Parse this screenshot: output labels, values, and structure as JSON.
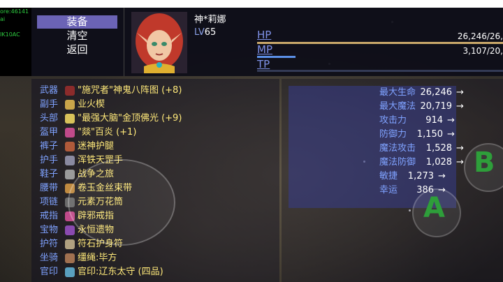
{
  "sidebar": {
    "lines": [
      "ore:46141",
      "ai",
      "",
      "IK10AC"
    ],
    "text_color": "#2ecc40"
  },
  "menu": {
    "items": [
      {
        "label": "装备",
        "selected": true
      },
      {
        "label": "清空",
        "selected": false
      },
      {
        "label": "返回",
        "selected": false
      }
    ],
    "selected_color": "#6b63b5"
  },
  "character": {
    "name": "神*莉娜",
    "level_label": "LV",
    "level": "65",
    "hp_label": "HP",
    "hp_value": "26,246/26,",
    "mp_label": "MP",
    "mp_value": "3,107/20,",
    "tp_label": "TP",
    "hp_fill": 1.0,
    "mp_fill": 0.15,
    "tp_fill": 0.0,
    "hp_color": "#c9a86a",
    "mp_color": "#5b8fe6"
  },
  "equipment": [
    {
      "slot": "武器",
      "icon": "weapon-icon",
      "color": "#8b2b2b",
      "name": "\"施咒者\"神鬼八阵图 (+8)"
    },
    {
      "slot": "副手",
      "icon": "wand-icon",
      "color": "#c9a54a",
      "name": "业火楔"
    },
    {
      "slot": "头部",
      "icon": "helmet-icon",
      "color": "#d8c25a",
      "name": "\"最强大脑\"金顶佛光 (+9)"
    },
    {
      "slot": "盔甲",
      "icon": "armor-icon",
      "color": "#c04a8a",
      "name": "\"燚\"百炎 (+1)"
    },
    {
      "slot": "裤子",
      "icon": "pants-icon",
      "color": "#b05a3a",
      "name": "迷神护腿"
    },
    {
      "slot": "护手",
      "icon": "gloves-icon",
      "color": "#8a8aa0",
      "name": "浑铁天罡手"
    },
    {
      "slot": "鞋子",
      "icon": "boots-icon",
      "color": "#9a9a9a",
      "name": "战争之旅"
    },
    {
      "slot": "腰带",
      "icon": "belt-icon",
      "color": "#c08a40",
      "name": "卷玉金丝束带"
    },
    {
      "slot": "项链",
      "icon": "necklace-icon",
      "color": "#6a6a6a",
      "name": "元素万花筒"
    },
    {
      "slot": "戒指",
      "icon": "ring-icon",
      "color": "#c04a8a",
      "name": "辟邪戒指"
    },
    {
      "slot": "宝物",
      "icon": "treasure-icon",
      "color": "#8a4ab0",
      "name": "永恒遗物"
    },
    {
      "slot": "护符",
      "icon": "amulet-icon",
      "color": "#b0a080",
      "name": "符石护身符"
    },
    {
      "slot": "坐骑",
      "icon": "mount-icon",
      "color": "#a07050",
      "name": "缰绳:毕方"
    },
    {
      "slot": "官印",
      "icon": "seal-icon",
      "color": "#5aa0c0",
      "name": "官印:辽东太守 (四品)"
    }
  ],
  "stats": [
    {
      "label": "最大生命",
      "value": "26,246",
      "arrow": "→"
    },
    {
      "label": "最大魔法",
      "value": "20,719",
      "arrow": "→"
    },
    {
      "label": "攻击力",
      "value": "914",
      "arrow": "→"
    },
    {
      "label": "防御力",
      "value": "1,150",
      "arrow": "→"
    },
    {
      "label": "魔法攻击",
      "value": "1,528",
      "arrow": "→"
    },
    {
      "label": "魔法防御",
      "value": "1,028",
      "arrow": "→"
    },
    {
      "label": "敏捷",
      "value": "1,273",
      "arrow": "→"
    },
    {
      "label": "幸运",
      "value": "386",
      "arrow": "→"
    }
  ],
  "buttons": {
    "a_label": "A",
    "b_label": "B",
    "a_color": "#2e9e3a",
    "b_color": "#2e9e3a"
  }
}
